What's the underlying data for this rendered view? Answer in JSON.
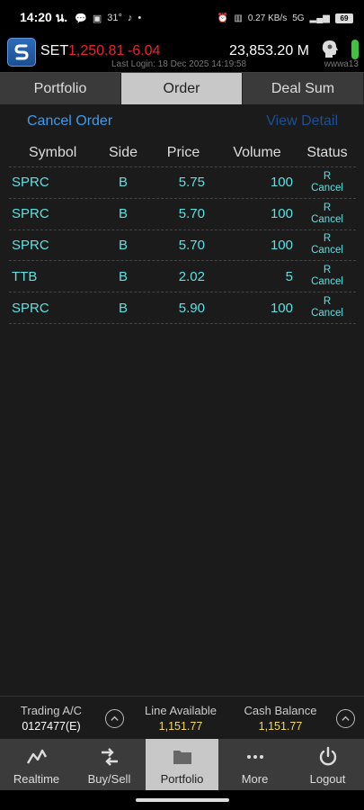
{
  "status_bar": {
    "time": "14:20 น.",
    "temperature": "31°",
    "network_speed": "0.27 KB/s",
    "network_type": "5G",
    "battery": "69"
  },
  "market": {
    "index_name": "SET",
    "index_value": "1,250.81",
    "index_change": "-6.04",
    "market_value": "23,853.20 M",
    "last_login": "Last Login: 18 Dec 2025 14:19:58",
    "user_id": "wwwa13",
    "colors": {
      "down": "#e8232e",
      "status_online": "#3fc33f"
    }
  },
  "tabs": [
    {
      "label": "Portfolio",
      "active": false
    },
    {
      "label": "Order",
      "active": true
    },
    {
      "label": "Deal Sum",
      "active": false
    }
  ],
  "order_panel": {
    "cancel_order_label": "Cancel Order",
    "view_detail_label": "View Detail",
    "columns": [
      "Symbol",
      "Side",
      "Price",
      "Volume",
      "Status"
    ],
    "rows": [
      {
        "symbol": "SPRC",
        "side": "B",
        "price": "5.75",
        "volume": "100",
        "status": "R",
        "action": "Cancel"
      },
      {
        "symbol": "SPRC",
        "side": "B",
        "price": "5.70",
        "volume": "100",
        "status": "R",
        "action": "Cancel"
      },
      {
        "symbol": "SPRC",
        "side": "B",
        "price": "5.70",
        "volume": "100",
        "status": "R",
        "action": "Cancel"
      },
      {
        "symbol": "TTB",
        "side": "B",
        "price": "2.02",
        "volume": "5",
        "status": "R",
        "action": "Cancel"
      },
      {
        "symbol": "SPRC",
        "side": "B",
        "price": "5.90",
        "volume": "100",
        "status": "R",
        "action": "Cancel"
      }
    ]
  },
  "account": {
    "trading_label": "Trading A/C",
    "trading_value": "0127477(E)",
    "line_label": "Line Available",
    "line_value": "1,151.77",
    "cash_label": "Cash Balance",
    "cash_value": "1,151.77"
  },
  "bottom_nav": [
    {
      "label": "Realtime",
      "icon": "realtime-chart-icon",
      "active": false
    },
    {
      "label": "Buy/Sell",
      "icon": "buy-sell-arrows-icon",
      "active": false
    },
    {
      "label": "Portfolio",
      "icon": "folder-icon",
      "active": true
    },
    {
      "label": "More",
      "icon": "more-dots-icon",
      "active": false
    },
    {
      "label": "Logout",
      "icon": "power-icon",
      "active": false
    }
  ]
}
